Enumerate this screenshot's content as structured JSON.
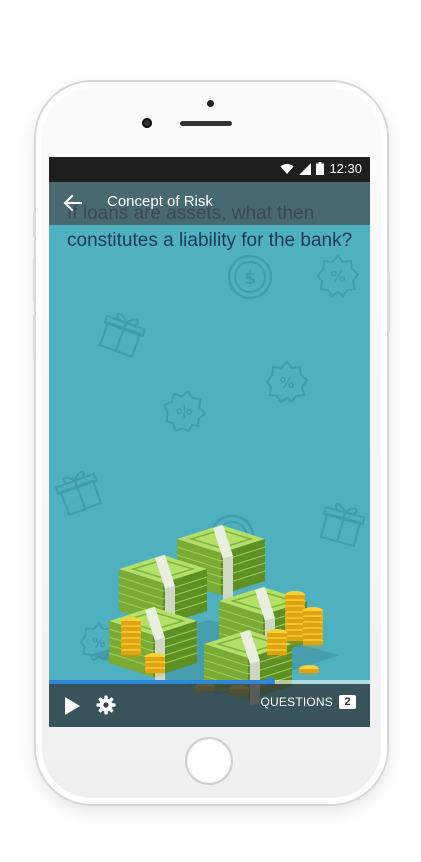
{
  "status_bar": {
    "time": "12:30",
    "icons": [
      "wifi-icon",
      "cell-signal-icon",
      "battery-icon"
    ]
  },
  "app_bar": {
    "back_icon": "arrow-left-icon",
    "title": "Concept of Risk"
  },
  "lesson": {
    "question": "If loans are assets, what then constitutes a liability for the bank?",
    "illustration": "money-stacks-illustration",
    "background_icons": [
      "dollar-coin-icon",
      "percent-badge-icon",
      "gift-icon"
    ]
  },
  "player": {
    "progress": 0.69,
    "play_icon": "play-icon",
    "settings_icon": "gear-icon",
    "questions_label": "QUESTIONS",
    "questions_count": "2"
  },
  "colors": {
    "screen_bg": "#4fb0c0",
    "question_text": "#1f3a55",
    "progress": "#2e86d6",
    "bill_green": "#8cc63f",
    "coin_gold": "#f5c518"
  }
}
